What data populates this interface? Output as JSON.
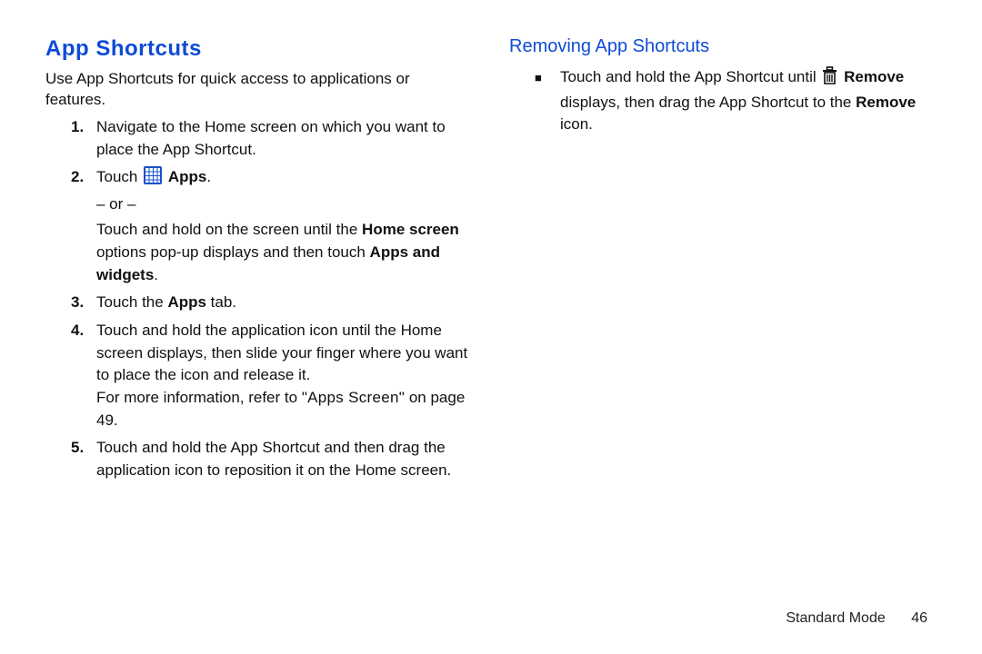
{
  "left": {
    "heading": "App Shortcuts",
    "intro": "Use App Shortcuts for quick access to applications or features.",
    "steps": {
      "s1": "Navigate to the Home screen on which you want to place the App Shortcut.",
      "s2_touch": "Touch ",
      "s2_apps": "Apps",
      "s2_or": "– or –",
      "s2_alt_a": "Touch and hold on the screen until the ",
      "s2_alt_home": "Home screen",
      "s2_alt_b": " options pop-up displays and then touch ",
      "s2_alt_aw": "Apps and widgets",
      "s3_a": "Touch the ",
      "s3_apps": "Apps",
      "s3_b": " tab.",
      "s4": "Touch and hold the application icon until the Home screen displays, then slide your finger where you want to place the icon and release it.",
      "s4_ref_a": "For more information, refer to ",
      "s4_ref_title": "\"Apps Screen\"",
      "s4_ref_b": " on page 49.",
      "s5": "Touch and hold the App Shortcut and then drag the application icon to reposition it on the Home screen."
    },
    "nums": {
      "n1": "1.",
      "n2": "2.",
      "n3": "3.",
      "n4": "4.",
      "n5": "5."
    }
  },
  "right": {
    "heading": "Removing App Shortcuts",
    "bullet": {
      "a": "Touch and hold the App Shortcut until ",
      "remove": "Remove",
      "b": " displays, then drag the App Shortcut to the ",
      "remove2": "Remove",
      "c": " icon."
    }
  },
  "footer": {
    "mode": "Standard Mode",
    "page": "46"
  },
  "period": "."
}
